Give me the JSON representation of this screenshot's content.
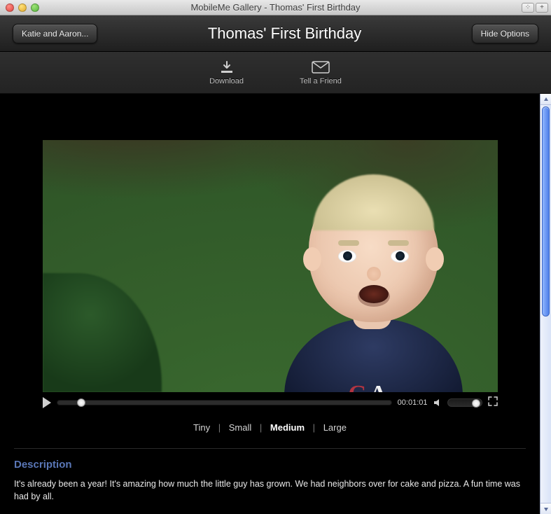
{
  "window": {
    "title": "MobileMe Gallery - Thomas' First Birthday"
  },
  "header": {
    "back_label": "Katie and Aaron...",
    "page_title": "Thomas' First Birthday",
    "hide_options_label": "Hide Options"
  },
  "options": {
    "download_label": "Download",
    "tell_friend_label": "Tell a Friend"
  },
  "player": {
    "time": "00:01:01"
  },
  "sizes": {
    "tiny": "Tiny",
    "small": "Small",
    "medium": "Medium",
    "large": "Large",
    "active": "medium"
  },
  "description": {
    "heading": "Description",
    "body": "It's already been a year! It's amazing how much the little guy has grown. We had neighbors over for cake and pizza. A fun time was had by all."
  }
}
